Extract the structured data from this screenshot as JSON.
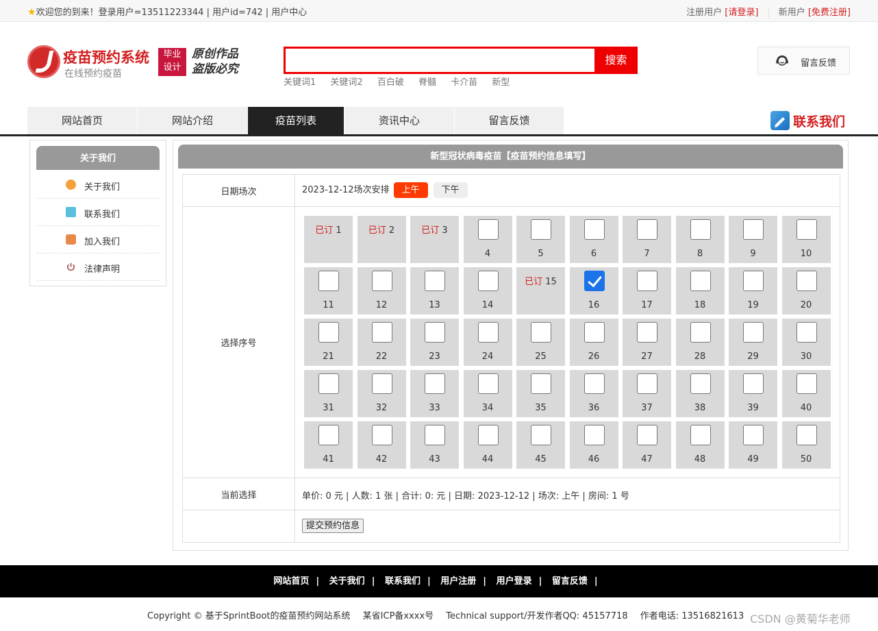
{
  "topbar": {
    "welcome": "欢迎您的到来！登录用户=13511223344 | 用户id=742 | 用户中心",
    "register_text": "注册用户",
    "login_link": "[请登录]",
    "new_user_text": "新用户",
    "signup_link": "[免费注册]"
  },
  "header": {
    "logo_title": "疫苗预约系统",
    "logo_subtitle": "在线预约疫苗",
    "badge_line1": "毕业",
    "badge_line2": "设计",
    "slogan_line1": "原创作品",
    "slogan_line2": "盗版必究",
    "search_placeholder": "",
    "search_button": "搜索",
    "keywords": [
      "关键词1",
      "关键词2",
      "百白破",
      "脊髓",
      "卡介苗",
      "新型"
    ],
    "feedback_button": "留言反馈"
  },
  "nav": {
    "items": [
      "网站首页",
      "网站介绍",
      "疫苗列表",
      "资讯中心",
      "留言反馈"
    ],
    "active_index": 2,
    "contact_label": "联系我们"
  },
  "sidebar": {
    "title": "关于我们",
    "items": [
      {
        "label": "关于我们",
        "icon": "orange-circle-icon"
      },
      {
        "label": "联系我们",
        "icon": "clipboard-icon"
      },
      {
        "label": "加入我们",
        "icon": "lock-icon"
      },
      {
        "label": "法律声明",
        "icon": "power-icon"
      }
    ]
  },
  "main": {
    "title": "新型冠状病毒疫苗【疫苗预约信息填写】",
    "date_label": "日期场次",
    "date_text": "2023-12-12场次安排",
    "session_am": "上午",
    "session_pm": "下午",
    "seat_label": "选择序号",
    "booked_text": "已订",
    "seats": {
      "total": 50,
      "booked": [
        1,
        2,
        3,
        15
      ],
      "selected": [
        16
      ]
    },
    "current_label": "当前选择",
    "current_text": "单价: 0 元 | 人数: 1 张 | 合计: 0:  元 | 日期: 2023-12-12 | 场次: 上午 | 房间: 1 号",
    "submit_button": "提交预约信息"
  },
  "footer": {
    "links": [
      "网站首页",
      "关于我们",
      "联系我们",
      "用户注册",
      "用户登录",
      "留言反馈"
    ],
    "copyright": "Copyright © 基于SprintBoot的疫苗预约网站系统",
    "icp": "某省ICP备xxxx号",
    "support": "Technical support/开发作者QQ: 45157718",
    "phone": "作者电话: 13516821613",
    "watermark": "CSDN @黄菊华老师"
  },
  "colors": {
    "brand_red": "#d31f1f",
    "search_red": "#ee0000",
    "session_active": "#ff3a00",
    "nav_active": "#222222",
    "checkbox_checked": "#1a73e8"
  }
}
